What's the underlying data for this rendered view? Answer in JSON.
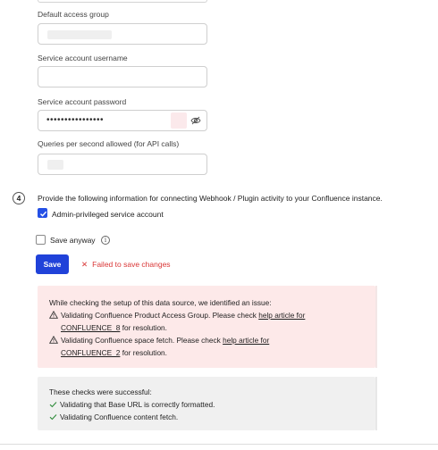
{
  "form": {
    "default_access_group": {
      "label": "Default access group",
      "value": ""
    },
    "service_username": {
      "label": "Service account username",
      "value": ""
    },
    "service_password": {
      "label": "Service account password",
      "value": "••••••••••••••••"
    },
    "qps": {
      "label": "Queries per second allowed (for API calls)",
      "value": ""
    }
  },
  "step": {
    "number": "4",
    "text": "Provide the following information for connecting Webhook / Plugin activity to your Confluence instance."
  },
  "admin_checkbox": {
    "label": "Admin-privileged service account",
    "checked": true
  },
  "save_anyway_checkbox": {
    "label": "Save anyway",
    "checked": false
  },
  "save_button": {
    "label": "Save"
  },
  "error_message": "Failed to save changes",
  "error_box": {
    "intro": "While checking the setup of this data source, we identified an issue:",
    "items": [
      {
        "text1": "Validating Confluence Product Access Group. Please check ",
        "link": "help article for",
        "link2": "CONFLUENCE_8",
        "text2": " for resolution."
      },
      {
        "text1": "Validating Confluence space fetch. Please check ",
        "link": "help article for",
        "link2": "CONFLUENCE_2",
        "text2": " for resolution."
      }
    ]
  },
  "success_box": {
    "intro": "These checks were successful:",
    "items": [
      "Validating that Base URL is correctly formatted.",
      "Validating Confluence content fetch."
    ]
  },
  "colors": {
    "primary": "#2042d9",
    "checkbox": "#2550e6",
    "error_text": "#d93636",
    "error_bg": "#fde9e9",
    "success_bg": "#f0f0f0",
    "success_icon": "#2e8b3a"
  }
}
